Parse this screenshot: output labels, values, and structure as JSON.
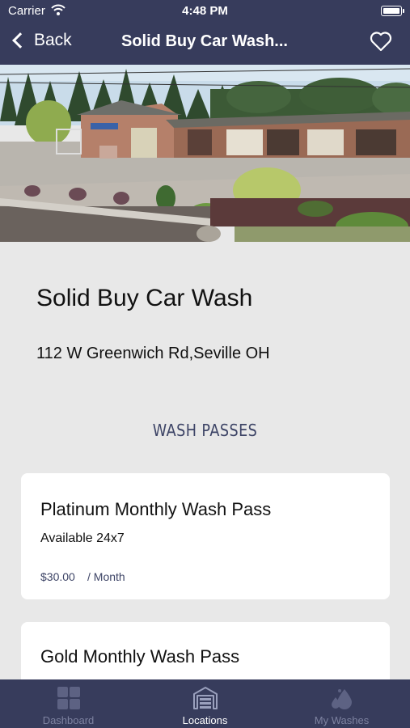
{
  "status_bar": {
    "carrier": "Carrier",
    "time": "4:48 PM"
  },
  "nav": {
    "back_label": "Back",
    "title": "Solid Buy Car Wash..."
  },
  "location": {
    "name": "Solid Buy Car Wash",
    "address": "112 W Greenwich Rd,Seville OH"
  },
  "section_title": "WASH PASSES",
  "passes": [
    {
      "title": "Platinum Monthly Wash Pass",
      "availability": "Available 24x7",
      "price": "$30.00",
      "period": "/ Month"
    },
    {
      "title": "Gold Monthly Wash Pass"
    }
  ],
  "tabs": [
    {
      "label": "Dashboard",
      "icon": "dashboard-icon",
      "active": false
    },
    {
      "label": "Locations",
      "icon": "garage-icon",
      "active": true
    },
    {
      "label": "My Washes",
      "icon": "water-drops-icon",
      "active": false
    }
  ],
  "colors": {
    "nav_bg": "#373c5c",
    "accent": "#3d4466",
    "background": "#e8e8e8"
  }
}
